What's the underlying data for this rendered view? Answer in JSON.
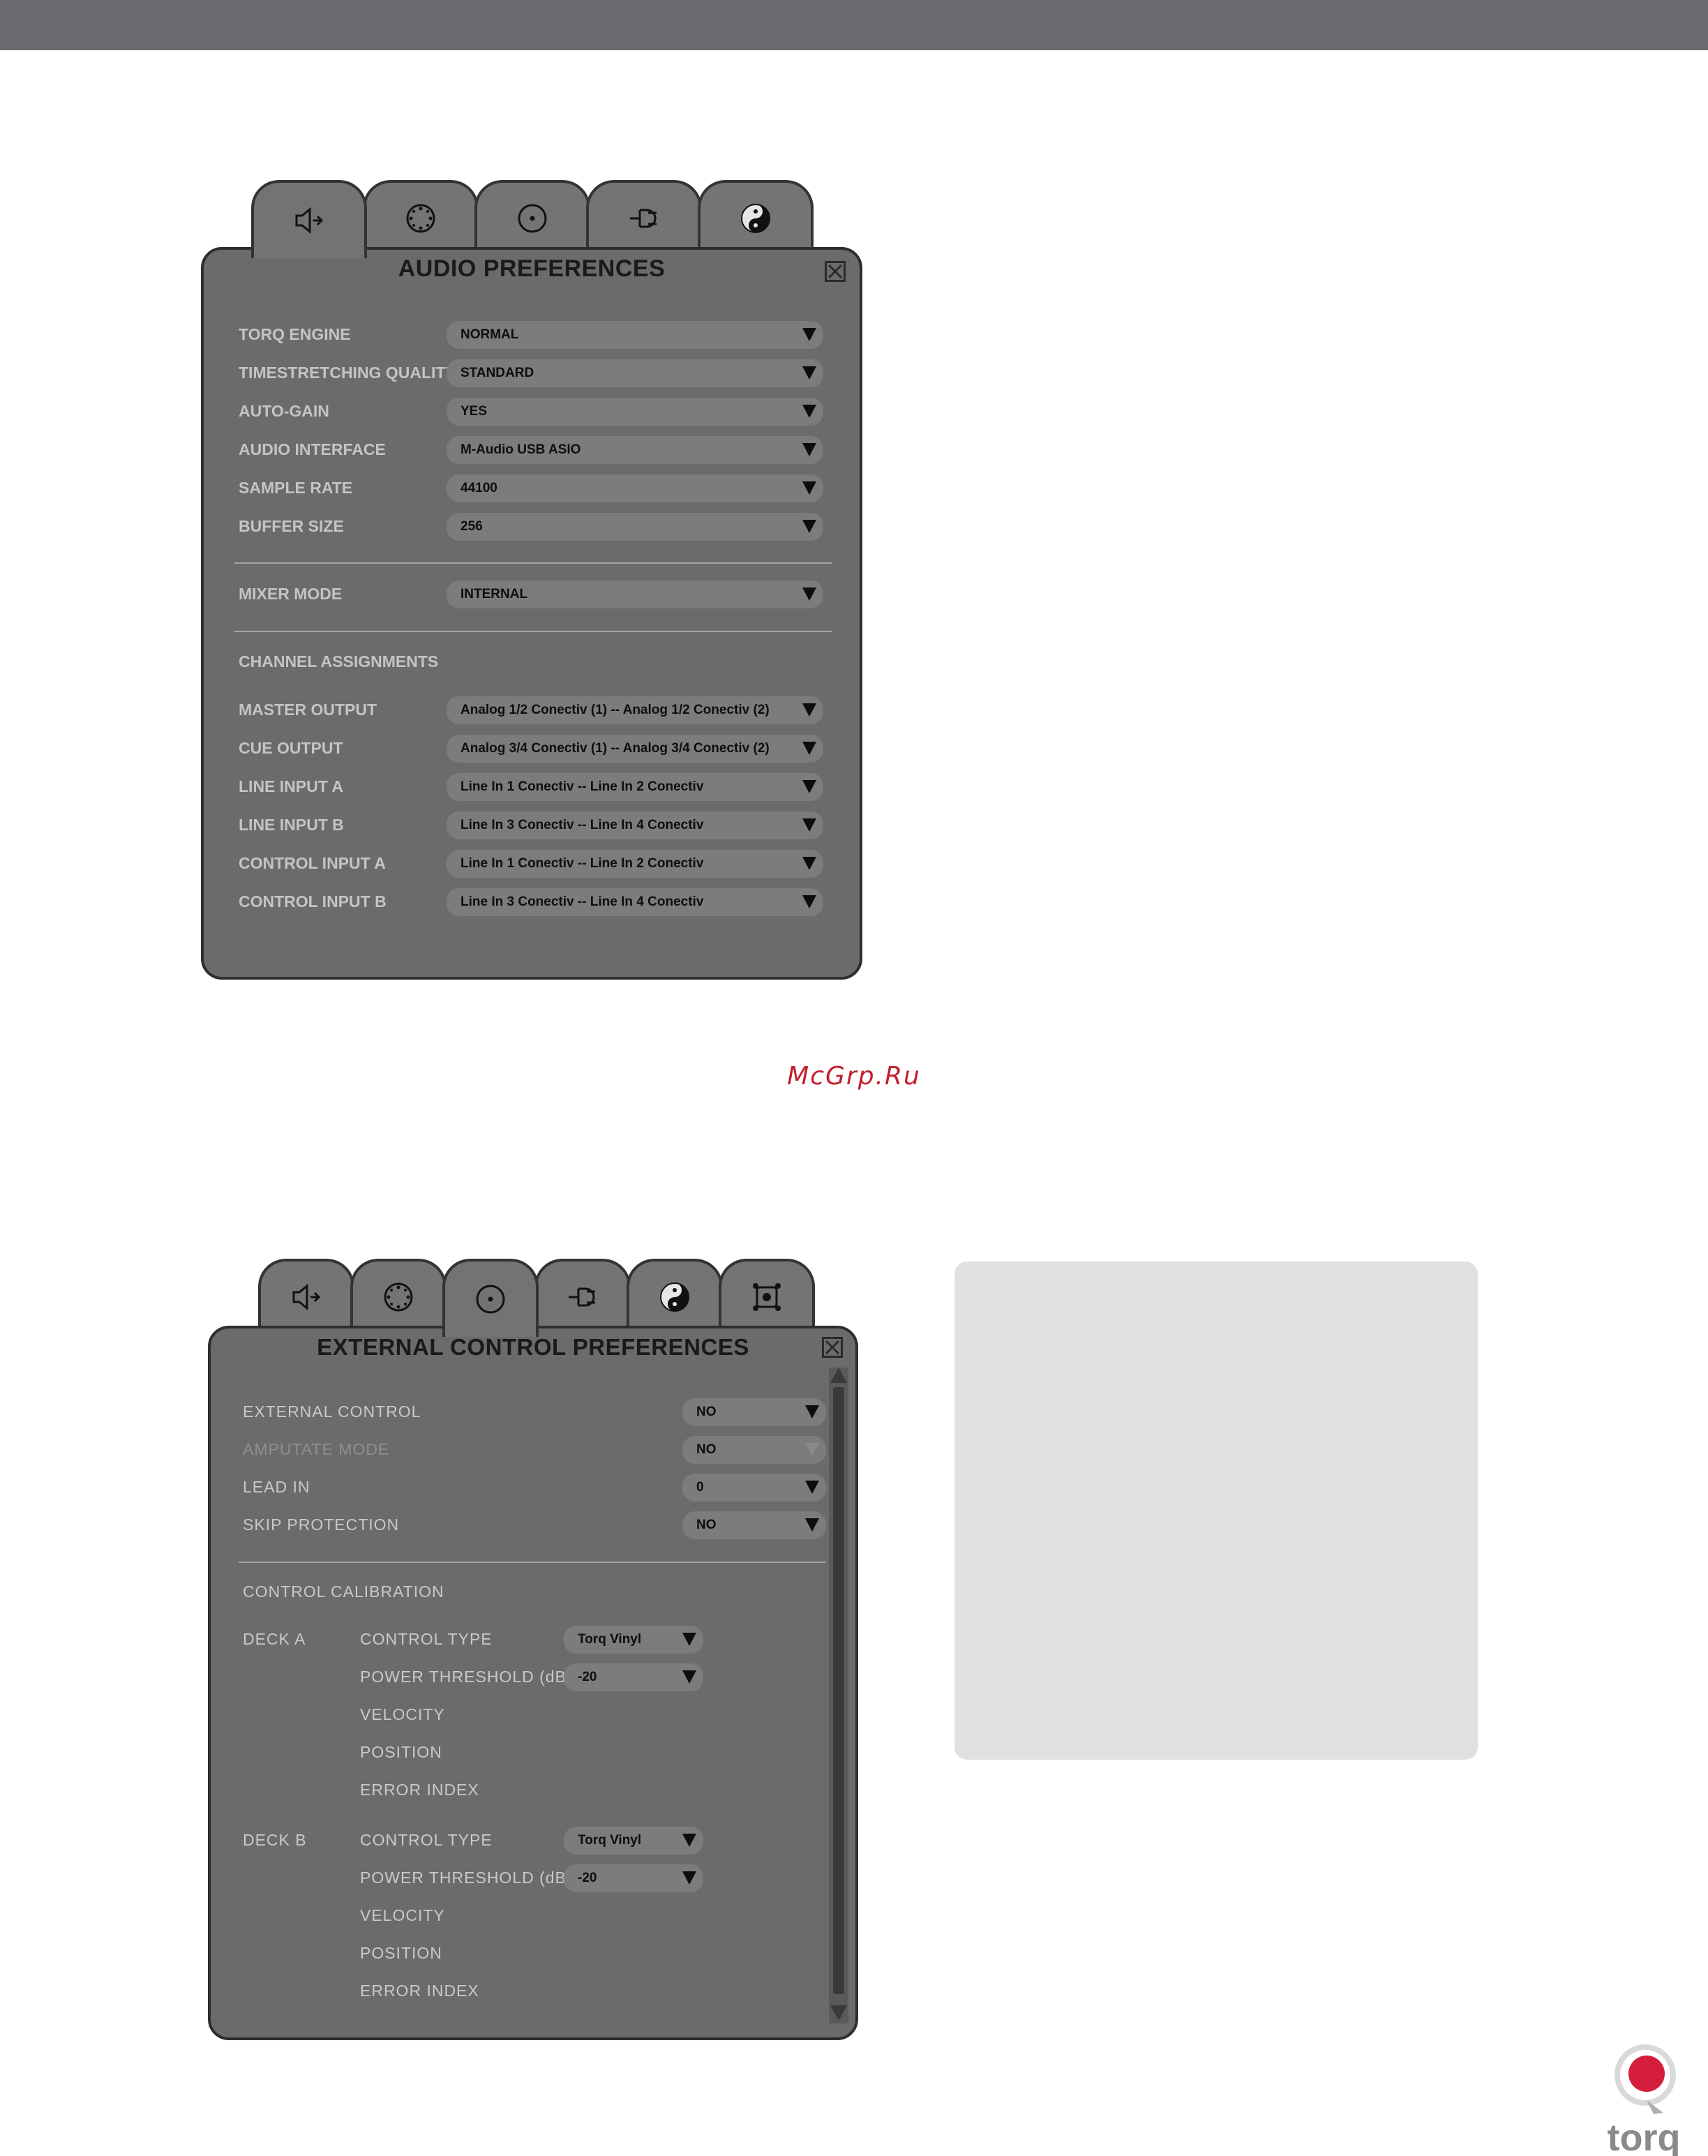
{
  "watermark": "McGrp.Ru",
  "window1": {
    "tabs": [
      {
        "icon": "speaker-icon"
      },
      {
        "icon": "jog-wheel-icon"
      },
      {
        "icon": "vinyl-record-icon"
      },
      {
        "icon": "plug-icon"
      },
      {
        "icon": "yin-yang-icon"
      }
    ],
    "title": "AUDIO PREFERENCES",
    "rows": [
      {
        "label": "TORQ ENGINE",
        "value": "NORMAL"
      },
      {
        "label": "TIMESTRETCHING QUALITY",
        "value": "STANDARD"
      },
      {
        "label": "AUTO-GAIN",
        "value": "YES"
      },
      {
        "label": "AUDIO INTERFACE",
        "value": "M-Audio USB ASIO"
      },
      {
        "label": "SAMPLE RATE",
        "value": "44100"
      },
      {
        "label": "BUFFER SIZE",
        "value": "256"
      }
    ],
    "mixer": {
      "label": "MIXER MODE",
      "value": "INTERNAL"
    },
    "channel_header": "CHANNEL ASSIGNMENTS",
    "channels": [
      {
        "label": "MASTER OUTPUT",
        "value": "Analog 1/2 Conectiv (1) -- Analog 1/2 Conectiv (2)"
      },
      {
        "label": "CUE OUTPUT",
        "value": "Analog 3/4 Conectiv (1) -- Analog 3/4 Conectiv (2)"
      },
      {
        "label": "LINE INPUT A",
        "value": "Line In 1 Conectiv -- Line In 2 Conectiv"
      },
      {
        "label": "LINE INPUT B",
        "value": "Line In 3 Conectiv -- Line In 4 Conectiv"
      },
      {
        "label": "CONTROL INPUT A",
        "value": "Line In 1 Conectiv -- Line In 2 Conectiv"
      },
      {
        "label": "CONTROL INPUT B",
        "value": "Line In 3 Conectiv -- Line In 4 Conectiv"
      }
    ]
  },
  "window2": {
    "tabs": [
      {
        "icon": "speaker-icon"
      },
      {
        "icon": "jog-wheel-icon"
      },
      {
        "icon": "vinyl-record-icon"
      },
      {
        "icon": "plug-icon"
      },
      {
        "icon": "yin-yang-icon"
      },
      {
        "icon": "controller-icon"
      }
    ],
    "title": "EXTERNAL CONTROL PREFERENCES",
    "rows": [
      {
        "label": "EXTERNAL CONTROL",
        "value": "NO"
      },
      {
        "label": "AMPUTATE MODE",
        "value": "NO"
      },
      {
        "label": "LEAD IN",
        "value": "0"
      },
      {
        "label": "SKIP PROTECTION",
        "value": "NO"
      }
    ],
    "calibration_header": "CONTROL CALIBRATION",
    "deck_a": {
      "label": "DECK A",
      "control_type_label": "CONTROL TYPE",
      "control_type_value": "Torq Vinyl",
      "power_label": "POWER THRESHOLD (dB)",
      "power_value": "-20",
      "velocity": "VELOCITY",
      "position": "POSITION",
      "error_index": "ERROR INDEX"
    },
    "deck_b": {
      "label": "DECK B",
      "control_type_label": "CONTROL TYPE",
      "control_type_value": "Torq Vinyl",
      "power_label": "POWER THRESHOLD (dB)",
      "power_value": "-20",
      "velocity": "VELOCITY",
      "position": "POSITION",
      "error_index": "ERROR INDEX"
    }
  },
  "logo_text": "torq",
  "colors": {
    "brand_red": "#d41e3c",
    "panel": "#6b6b6b",
    "topbar": "#686a6d"
  }
}
